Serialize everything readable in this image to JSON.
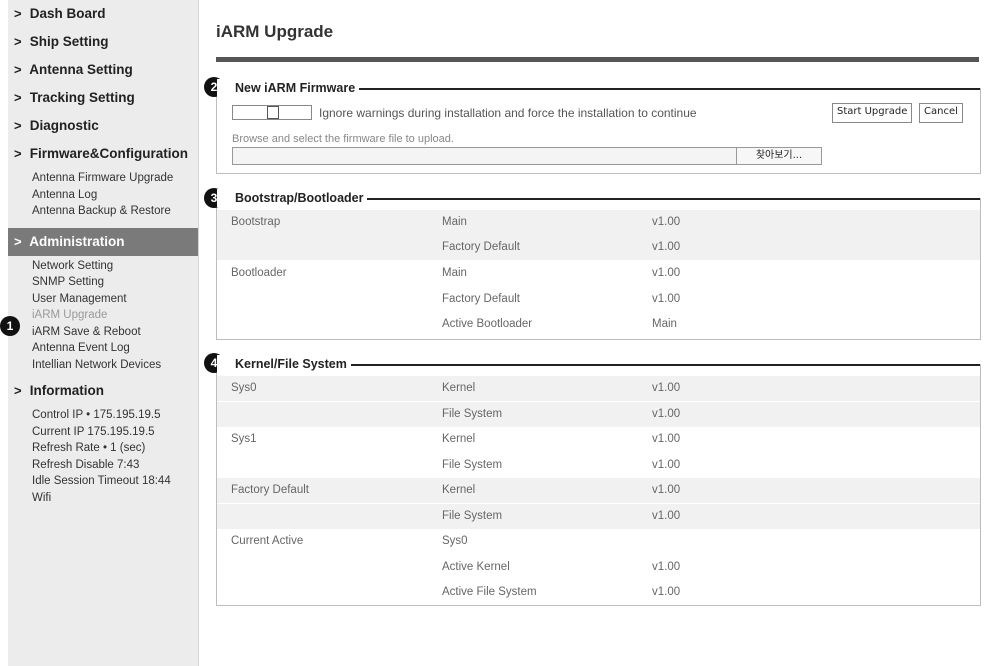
{
  "sidebar": {
    "dash_board": "Dash Board",
    "ship_setting": "Ship Setting",
    "antenna_setting": "Antenna Setting",
    "tracking_setting": "Tracking Setting",
    "diagnostic": "Diagnostic",
    "firmware_config": {
      "label": "Firmware&Configuration",
      "items": [
        "Antenna Firmware Upgrade",
        "Antenna Log",
        "Antenna Backup & Restore"
      ]
    },
    "administration": {
      "label": "Administration",
      "items": [
        "Network Setting",
        "SNMP Setting",
        "User Management",
        "iARM Upgrade",
        "iARM Save & Reboot",
        "Antenna Event Log",
        "Intellian Network Devices"
      ]
    },
    "information": {
      "label": "Information",
      "lines": [
        "Control IP • 175.195.19.5",
        "Current IP  175.195.19.5",
        "Refresh Rate •    1 (sec)",
        "Refresh Disable  7:43",
        "Idle Session Timeout  18:44",
        "Wifi"
      ]
    }
  },
  "badges": {
    "b1": "1",
    "b2": "2",
    "b3": "3",
    "b4": "4"
  },
  "page": {
    "title": "iARM Upgrade"
  },
  "firmware": {
    "legend": "New iARM Firmware",
    "ignore_label": "Ignore warnings during installation and force the installation to continue",
    "start_button": "Start Upgrade",
    "cancel_button": "Cancel",
    "browse_hint": "Browse and select the firmware file to upload.",
    "browse_button": "찾아보기...",
    "file_value": ""
  },
  "bootstrap": {
    "legend": "Bootstrap/Bootloader",
    "rows": [
      {
        "group": "Bootstrap",
        "name": "Main",
        "value": "v1.00"
      },
      {
        "group": "",
        "name": "Factory Default",
        "value": "v1.00"
      },
      {
        "group": "Bootloader",
        "name": "Main",
        "value": "v1.00"
      },
      {
        "group": "",
        "name": "Factory Default",
        "value": "v1.00"
      },
      {
        "group": "",
        "name": "Active Bootloader",
        "value": "Main"
      }
    ]
  },
  "kernel": {
    "legend": "Kernel/File System",
    "rows": [
      {
        "group": "Sys0",
        "name": "Kernel",
        "value": "v1.00"
      },
      {
        "group": "",
        "name": "File System",
        "value": "v1.00"
      },
      {
        "group": "Sys1",
        "name": "Kernel",
        "value": "v1.00"
      },
      {
        "group": "",
        "name": "File System",
        "value": "v1.00"
      },
      {
        "group": "Factory Default",
        "name": "Kernel",
        "value": "v1.00"
      },
      {
        "group": "",
        "name": "File System",
        "value": "v1.00"
      },
      {
        "group": "Current Active",
        "name": "Sys0",
        "value": ""
      },
      {
        "group": "",
        "name": "Active Kernel",
        "value": "v1.00"
      },
      {
        "group": "",
        "name": "Active File System",
        "value": "v1.00"
      }
    ]
  }
}
